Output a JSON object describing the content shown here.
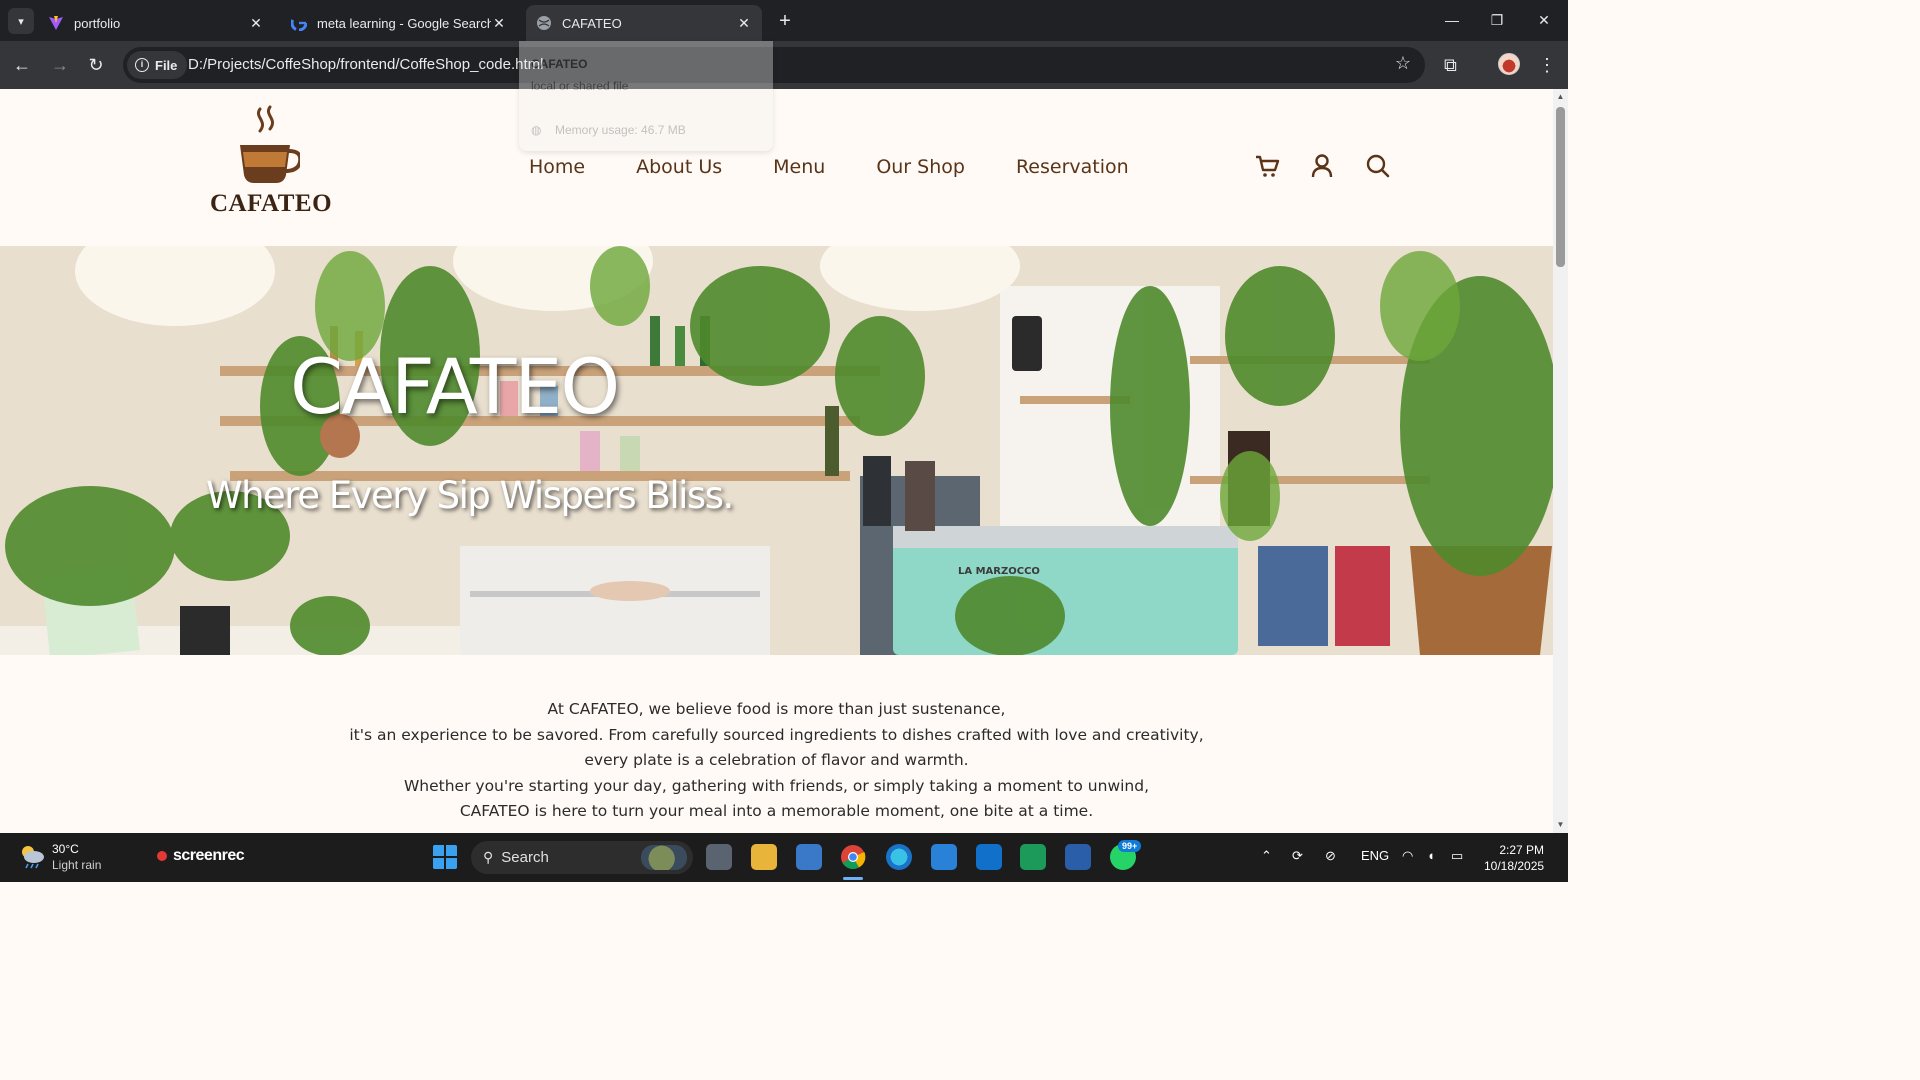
{
  "browser": {
    "tabs": [
      {
        "title": "portfolio",
        "favicon": "vite-logo-icon"
      },
      {
        "title": "meta learning - Google Search",
        "favicon": "google-logo-icon"
      },
      {
        "title": "CAFATEO",
        "favicon": "globe-icon",
        "active": true
      }
    ],
    "omnibox": {
      "chip_label": "File",
      "url": "D:/Projects/CoffeShop/frontend/CoffeShop_code.html"
    },
    "tab_tooltip": {
      "title": "CAFATEO",
      "subtitle": "local or shared file",
      "memory": "Memory usage: 46.7 MB"
    }
  },
  "site": {
    "logo_text": "CAFATEO",
    "nav": [
      "Home",
      "About Us",
      "Menu",
      "Our Shop",
      "Reservation"
    ],
    "hero": {
      "title": "CAFATEO",
      "subtitle": "Where Every Sip Wispers Bliss."
    },
    "about_lines": [
      "At CAFATEO, we believe food is more than just sustenance,",
      "it's an experience to be savored. From carefully sourced ingredients to dishes crafted with love and creativity,",
      "every plate is a celebration of flavor and warmth.",
      "Whether you're starting your day, gathering with friends, or simply taking a moment to unwind,",
      "CAFATEO is here to turn your meal into a memorable moment, one bite at a time."
    ],
    "colors": {
      "brand_brown": "#5a3418",
      "background": "#fffaf5"
    }
  },
  "taskbar": {
    "weather": {
      "temp": "30°C",
      "desc": "Light rain"
    },
    "screenrec": "screenrec",
    "search_placeholder": "Search",
    "whatsapp_badge": "99+",
    "language": "ENG",
    "time": "2:27 PM",
    "date": "10/18/2025"
  }
}
